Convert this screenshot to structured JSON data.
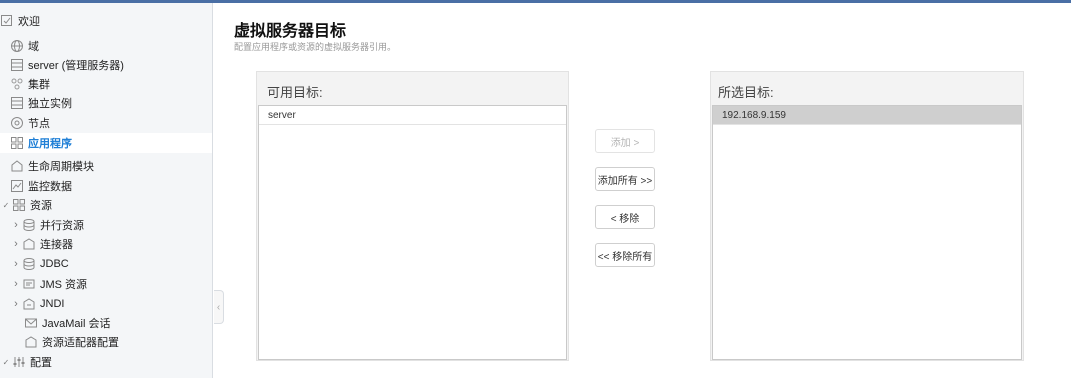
{
  "sidebar": {
    "items": [
      {
        "label": "欢迎",
        "icon": "checkbox-icon"
      },
      {
        "label": "域",
        "icon": "globe-icon"
      },
      {
        "label": "server (管理服务器)",
        "icon": "server-icon"
      },
      {
        "label": "集群",
        "icon": "cluster-icon"
      },
      {
        "label": "独立实例",
        "icon": "instance-icon"
      },
      {
        "label": "节点",
        "icon": "node-icon"
      },
      {
        "label": "应用程序",
        "icon": "applications-icon"
      },
      {
        "label": "生命周期模块",
        "icon": "lifecycle-icon"
      },
      {
        "label": "监控数据",
        "icon": "monitoring-icon"
      },
      {
        "label": "资源",
        "icon": "resources-icon"
      },
      {
        "label": "并行资源",
        "icon": "database-icon"
      },
      {
        "label": "连接器",
        "icon": "connector-icon"
      },
      {
        "label": "JDBC",
        "icon": "database-icon"
      },
      {
        "label": "JMS 资源",
        "icon": "jms-icon"
      },
      {
        "label": "JNDI",
        "icon": "jndi-icon"
      },
      {
        "label": "JavaMail 会话",
        "icon": "mail-icon"
      },
      {
        "label": "资源适配器配置",
        "icon": "adapter-icon"
      },
      {
        "label": "配置",
        "icon": "config-icon"
      }
    ],
    "expand_glyph": "›",
    "expanded_glyph": "✓"
  },
  "main": {
    "title": "虚拟服务器目标",
    "description": "配置应用程序或资源的虚拟服务器引用。",
    "available": {
      "header": "可用目标:",
      "items": [
        "server"
      ]
    },
    "selected": {
      "header": "所选目标:",
      "items": [
        "192.168.9.159"
      ]
    },
    "buttons": {
      "add": "添加 >",
      "add_all": "添加所有 >>",
      "remove": "< 移除",
      "remove_all": "<< 移除所有"
    }
  },
  "splitter_glyph": "‹",
  "colors": {
    "accent": "#1f7fd6",
    "topbar": "#4a6fa5",
    "selected_row": "#cfcfcf"
  }
}
